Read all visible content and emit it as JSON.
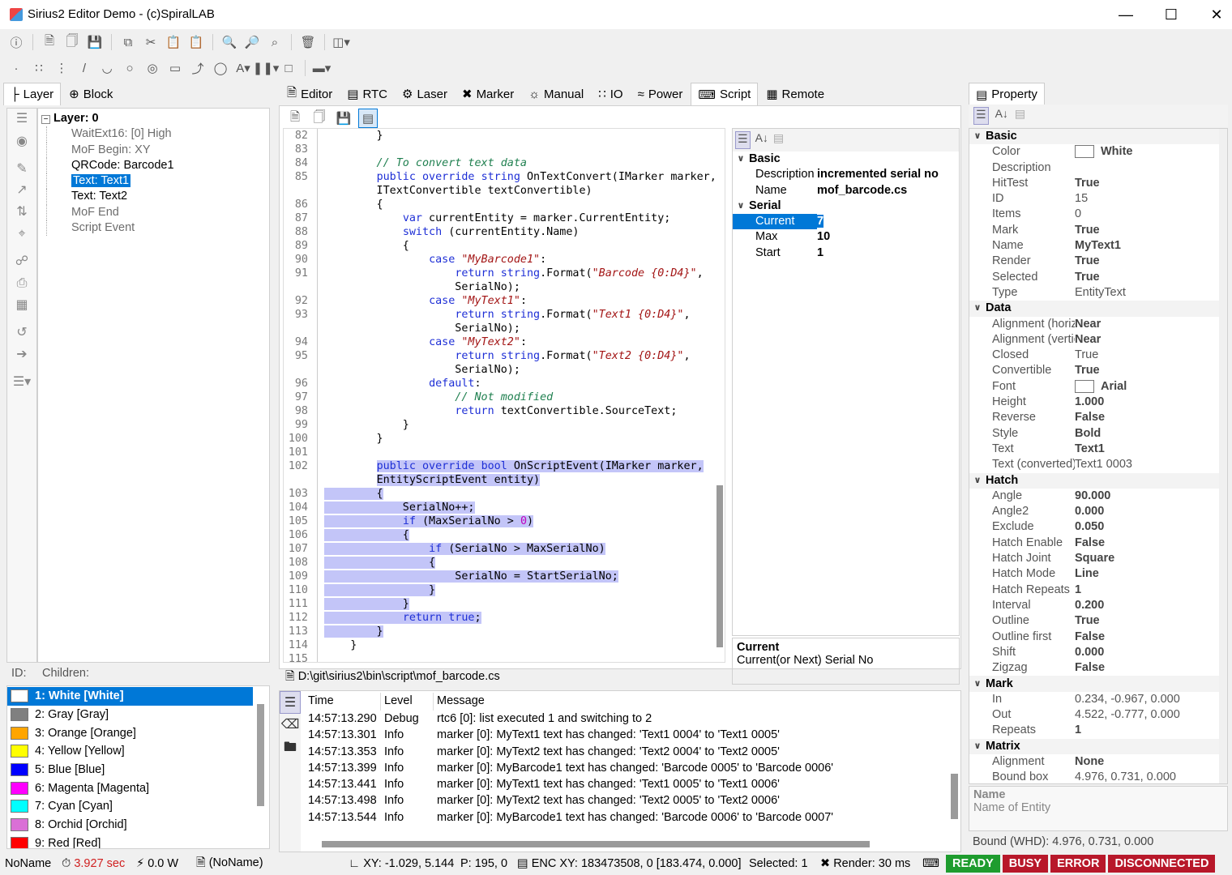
{
  "app": {
    "title": "Sirius2 Editor Demo - (c)SpiralLAB"
  },
  "left_tabs": [
    "Layer",
    "Block"
  ],
  "tree": {
    "root": "Layer: 0",
    "items": [
      {
        "label": "WaitExt16: [0] High",
        "style": "gray"
      },
      {
        "label": "MoF Begin: XY",
        "style": "gray"
      },
      {
        "label": "QRCode: Barcode1",
        "style": "normal"
      },
      {
        "label": "Text: Text1",
        "style": "selected"
      },
      {
        "label": "Text: Text2",
        "style": "normal"
      },
      {
        "label": "MoF End",
        "style": "gray"
      },
      {
        "label": "Script Event",
        "style": "gray"
      }
    ],
    "id_label": "ID:",
    "children_label": "Children:"
  },
  "pens": [
    {
      "label": "1: White [White]",
      "color": "#ffffff"
    },
    {
      "label": "2: Gray [Gray]",
      "color": "#808080"
    },
    {
      "label": "3: Orange [Orange]",
      "color": "#ffa500"
    },
    {
      "label": "4: Yellow [Yellow]",
      "color": "#ffff00"
    },
    {
      "label": "5: Blue [Blue]",
      "color": "#0000ff"
    },
    {
      "label": "6: Magenta [Magenta]",
      "color": "#ff00ff"
    },
    {
      "label": "7: Cyan [Cyan]",
      "color": "#00ffff"
    },
    {
      "label": "8: Orchid [Orchid]",
      "color": "#da70d6"
    },
    {
      "label": "9: Red [Red]",
      "color": "#ff0000"
    }
  ],
  "center_tabs": [
    "Editor",
    "RTC",
    "Laser",
    "Marker",
    "Manual",
    "IO",
    "Power",
    "Script",
    "Remote"
  ],
  "script": {
    "path": "D:\\git\\sirius2\\bin\\script\\mof_barcode.cs",
    "lines": [
      {
        "n": "82",
        "t": "        }"
      },
      {
        "n": "83",
        "t": ""
      },
      {
        "n": "84",
        "t": "        // To convert text data"
      },
      {
        "n": "85",
        "t": "        public override string OnTextConvert(IMarker marker,"
      },
      {
        "n": "",
        "t": "        ITextConvertible textConvertible)"
      },
      {
        "n": "86",
        "t": "        {"
      },
      {
        "n": "87",
        "t": "            var currentEntity = marker.CurrentEntity;"
      },
      {
        "n": "88",
        "t": "            switch (currentEntity.Name)"
      },
      {
        "n": "89",
        "t": "            {"
      },
      {
        "n": "90",
        "t": "                case \"MyBarcode1\":"
      },
      {
        "n": "91",
        "t": "                    return string.Format(\"Barcode {0:D4}\","
      },
      {
        "n": "",
        "t": "                    SerialNo);"
      },
      {
        "n": "92",
        "t": "                case \"MyText1\":"
      },
      {
        "n": "93",
        "t": "                    return string.Format(\"Text1 {0:D4}\","
      },
      {
        "n": "",
        "t": "                    SerialNo);"
      },
      {
        "n": "94",
        "t": "                case \"MyText2\":"
      },
      {
        "n": "95",
        "t": "                    return string.Format(\"Text2 {0:D4}\","
      },
      {
        "n": "",
        "t": "                    SerialNo);"
      },
      {
        "n": "96",
        "t": "                default:"
      },
      {
        "n": "97",
        "t": "                    // Not modified"
      },
      {
        "n": "98",
        "t": "                    return textConvertible.SourceText;"
      },
      {
        "n": "99",
        "t": "            }"
      },
      {
        "n": "100",
        "t": "        }"
      },
      {
        "n": "101",
        "t": ""
      },
      {
        "n": "102",
        "t": "        public override bool OnScriptEvent(IMarker marker,"
      },
      {
        "n": "",
        "t": "        EntityScriptEvent entity)"
      },
      {
        "n": "103",
        "t": "        {"
      },
      {
        "n": "104",
        "t": "            SerialNo++;"
      },
      {
        "n": "105",
        "t": "            if (MaxSerialNo > 0)"
      },
      {
        "n": "106",
        "t": "            {"
      },
      {
        "n": "107",
        "t": "                if (SerialNo > MaxSerialNo)"
      },
      {
        "n": "108",
        "t": "                {"
      },
      {
        "n": "109",
        "t": "                    SerialNo = StartSerialNo;"
      },
      {
        "n": "110",
        "t": "                }"
      },
      {
        "n": "111",
        "t": "            }"
      },
      {
        "n": "112",
        "t": "            return true;"
      },
      {
        "n": "113",
        "t": "        }"
      },
      {
        "n": "114",
        "t": "    }"
      },
      {
        "n": "115",
        "t": ""
      }
    ]
  },
  "script_props": {
    "basic_label": "Basic",
    "rows": [
      {
        "name": "Description",
        "value": "incremented serial no"
      },
      {
        "name": "Name",
        "value": "mof_barcode.cs"
      }
    ],
    "serial_label": "Serial",
    "serial": [
      {
        "name": "Current",
        "value": "7"
      },
      {
        "name": "Max",
        "value": "10"
      },
      {
        "name": "Start",
        "value": "1"
      }
    ],
    "help_title": "Current",
    "help_text": "Current(or Next) Serial No"
  },
  "log": {
    "headers": [
      "Time",
      "Level",
      "Message"
    ],
    "rows": [
      [
        "14:57:13.290",
        "Debug",
        "rtc6 [0]: list executed 1 and switching to 2"
      ],
      [
        "14:57:13.301",
        "Info",
        "marker [0]: MyText1 text has changed: 'Text1 0004' to 'Text1 0005'"
      ],
      [
        "14:57:13.353",
        "Info",
        "marker [0]: MyText2 text has changed: 'Text2 0004' to 'Text2 0005'"
      ],
      [
        "14:57:13.399",
        "Info",
        "marker [0]: MyBarcode1 text has changed: 'Barcode 0005' to 'Barcode 0006'"
      ],
      [
        "14:57:13.441",
        "Info",
        "marker [0]: MyText1 text has changed: 'Text1 0005' to 'Text1 0006'"
      ],
      [
        "14:57:13.498",
        "Info",
        "marker [0]: MyText2 text has changed: 'Text2 0005' to 'Text2 0006'"
      ],
      [
        "14:57:13.544",
        "Info",
        "marker [0]: MyBarcode1 text has changed: 'Barcode 0006' to 'Barcode 0007'"
      ]
    ]
  },
  "property": {
    "tab": "Property",
    "groups": [
      {
        "label": "Basic",
        "rows": [
          {
            "name": "Color",
            "value": "White",
            "bold": true,
            "swatch": true
          },
          {
            "name": "Description",
            "value": ""
          },
          {
            "name": "HitTest",
            "value": "True",
            "bold": true
          },
          {
            "name": "ID",
            "value": "15"
          },
          {
            "name": "Items",
            "value": "0"
          },
          {
            "name": "Mark",
            "value": "True",
            "bold": true
          },
          {
            "name": "Name",
            "value": "MyText1",
            "bold": true
          },
          {
            "name": "Render",
            "value": "True",
            "bold": true
          },
          {
            "name": "Selected",
            "value": "True",
            "bold": true
          },
          {
            "name": "Type",
            "value": "EntityText"
          }
        ]
      },
      {
        "label": "Data",
        "rows": [
          {
            "name": "Alignment (horizontal)",
            "value": "Near",
            "bold": true
          },
          {
            "name": "Alignment (vertical)",
            "value": "Near",
            "bold": true
          },
          {
            "name": "Closed",
            "value": "True"
          },
          {
            "name": "Convertible",
            "value": "True",
            "bold": true
          },
          {
            "name": "Font",
            "value": "Arial",
            "bold": true,
            "swatch": true
          },
          {
            "name": "Height",
            "value": "1.000",
            "bold": true
          },
          {
            "name": "Reverse",
            "value": "False",
            "bold": true
          },
          {
            "name": "Style",
            "value": "Bold",
            "bold": true
          },
          {
            "name": "Text",
            "value": "Text1",
            "bold": true
          },
          {
            "name": "Text (converted)",
            "value": "Text1 0003"
          }
        ]
      },
      {
        "label": "Hatch",
        "rows": [
          {
            "name": "Angle",
            "value": "90.000",
            "bold": true
          },
          {
            "name": "Angle2",
            "value": "0.000",
            "bold": true
          },
          {
            "name": "Exclude",
            "value": "0.050",
            "bold": true
          },
          {
            "name": "Hatch Enable",
            "value": "False",
            "bold": true
          },
          {
            "name": "Hatch Joint",
            "value": "Square",
            "bold": true
          },
          {
            "name": "Hatch Mode",
            "value": "Line",
            "bold": true
          },
          {
            "name": "Hatch Repeats",
            "value": "1",
            "bold": true
          },
          {
            "name": "Interval",
            "value": "0.200",
            "bold": true
          },
          {
            "name": "Outline",
            "value": "True",
            "bold": true
          },
          {
            "name": "Outline first",
            "value": "False",
            "bold": true
          },
          {
            "name": "Shift",
            "value": "0.000",
            "bold": true
          },
          {
            "name": "Zigzag",
            "value": "False",
            "bold": true
          }
        ]
      },
      {
        "label": "Mark",
        "rows": [
          {
            "name": "In",
            "value": "0.234, -0.967, 0.000"
          },
          {
            "name": "Out",
            "value": "4.522, -0.777, 0.000"
          },
          {
            "name": "Repeats",
            "value": "1",
            "bold": true
          }
        ]
      },
      {
        "label": "Matrix",
        "rows": [
          {
            "name": "Alignment",
            "value": "None",
            "bold": true
          },
          {
            "name": "Bound box",
            "value": "4.976, 0.731, 0.000"
          }
        ]
      }
    ],
    "help_title": "Name",
    "help_text": "Name of Entity",
    "bound": "Bound (WHD): 4.976, 0.731, 0.000"
  },
  "status": {
    "name": "NoName",
    "time": "3.927 sec",
    "power": "0.0 W",
    "doc": "(NoName)",
    "xy": "XY: -1.029, 5.144",
    "p": "P: 195, 0",
    "enc": "ENC XY: 183473508, 0 [183.474, 0.000]",
    "selected": "Selected: 1",
    "render": "Render: 30 ms",
    "badges": [
      {
        "label": "READY",
        "color": "#1e9c2e"
      },
      {
        "label": "BUSY",
        "color": "#b8182a"
      },
      {
        "label": "ERROR",
        "color": "#b8182a"
      },
      {
        "label": "DISCONNECTED",
        "color": "#b8182a"
      }
    ]
  }
}
